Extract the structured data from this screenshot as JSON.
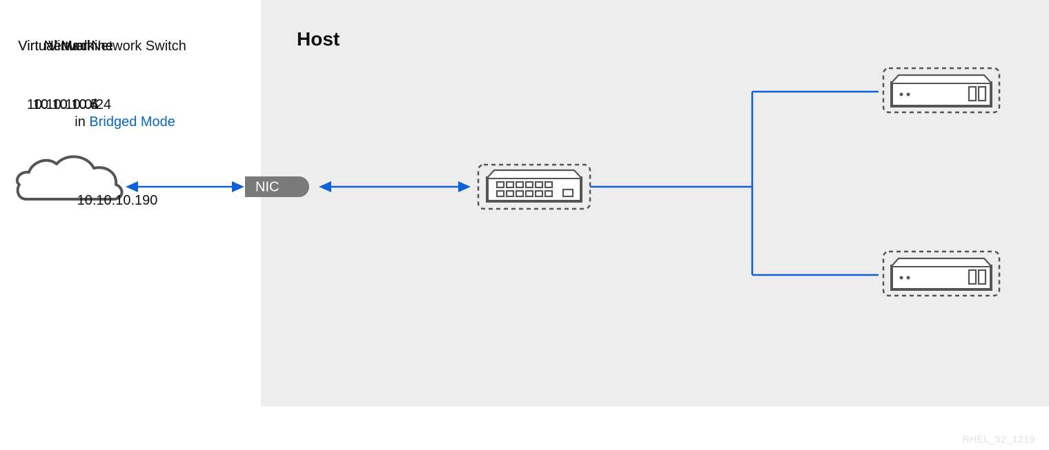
{
  "host_title": "Host",
  "network": {
    "label": "Network",
    "ip": "10.10.10.0/24"
  },
  "nic": {
    "label": "NIC"
  },
  "switch": {
    "label_line1": "Virtual Network Switch",
    "label_line2_prefix": "in ",
    "label_line2_emphasis": "Bridged Mode",
    "ip": "10.10.10.190"
  },
  "vm1": {
    "label": "Virtual Machine",
    "ip": "10.10.10.4"
  },
  "vm2": {
    "label": "Virtual Machine",
    "ip": "10.10.10.5"
  },
  "watermark": "RHEL_52_1219",
  "colors": {
    "accent_blue": "#1161d6",
    "gray_fill": "#ededed",
    "nic_fill": "#7a7a7a"
  }
}
